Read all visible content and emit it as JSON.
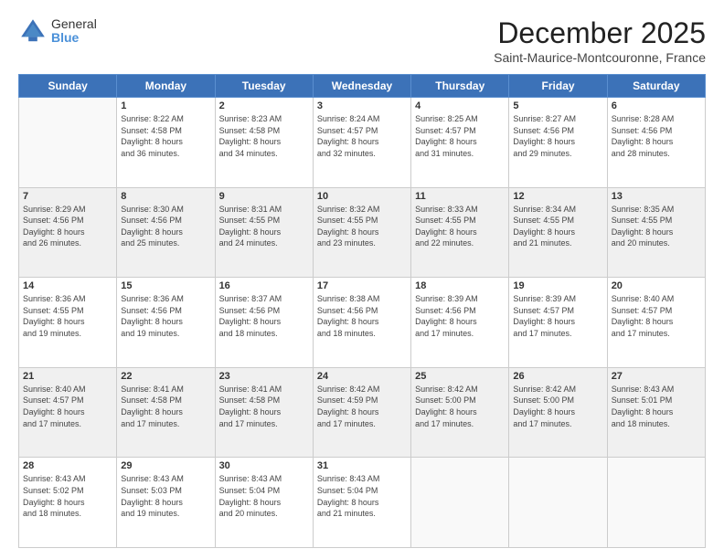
{
  "header": {
    "logo": {
      "general": "General",
      "blue": "Blue"
    },
    "title": "December 2025",
    "location": "Saint-Maurice-Montcouronne, France"
  },
  "weekdays": [
    "Sunday",
    "Monday",
    "Tuesday",
    "Wednesday",
    "Thursday",
    "Friday",
    "Saturday"
  ],
  "weeks": [
    [
      {
        "day": "",
        "info": ""
      },
      {
        "day": "1",
        "info": "Sunrise: 8:22 AM\nSunset: 4:58 PM\nDaylight: 8 hours\nand 36 minutes."
      },
      {
        "day": "2",
        "info": "Sunrise: 8:23 AM\nSunset: 4:58 PM\nDaylight: 8 hours\nand 34 minutes."
      },
      {
        "day": "3",
        "info": "Sunrise: 8:24 AM\nSunset: 4:57 PM\nDaylight: 8 hours\nand 32 minutes."
      },
      {
        "day": "4",
        "info": "Sunrise: 8:25 AM\nSunset: 4:57 PM\nDaylight: 8 hours\nand 31 minutes."
      },
      {
        "day": "5",
        "info": "Sunrise: 8:27 AM\nSunset: 4:56 PM\nDaylight: 8 hours\nand 29 minutes."
      },
      {
        "day": "6",
        "info": "Sunrise: 8:28 AM\nSunset: 4:56 PM\nDaylight: 8 hours\nand 28 minutes."
      }
    ],
    [
      {
        "day": "7",
        "info": "Sunrise: 8:29 AM\nSunset: 4:56 PM\nDaylight: 8 hours\nand 26 minutes."
      },
      {
        "day": "8",
        "info": "Sunrise: 8:30 AM\nSunset: 4:56 PM\nDaylight: 8 hours\nand 25 minutes."
      },
      {
        "day": "9",
        "info": "Sunrise: 8:31 AM\nSunset: 4:55 PM\nDaylight: 8 hours\nand 24 minutes."
      },
      {
        "day": "10",
        "info": "Sunrise: 8:32 AM\nSunset: 4:55 PM\nDaylight: 8 hours\nand 23 minutes."
      },
      {
        "day": "11",
        "info": "Sunrise: 8:33 AM\nSunset: 4:55 PM\nDaylight: 8 hours\nand 22 minutes."
      },
      {
        "day": "12",
        "info": "Sunrise: 8:34 AM\nSunset: 4:55 PM\nDaylight: 8 hours\nand 21 minutes."
      },
      {
        "day": "13",
        "info": "Sunrise: 8:35 AM\nSunset: 4:55 PM\nDaylight: 8 hours\nand 20 minutes."
      }
    ],
    [
      {
        "day": "14",
        "info": "Sunrise: 8:36 AM\nSunset: 4:55 PM\nDaylight: 8 hours\nand 19 minutes."
      },
      {
        "day": "15",
        "info": "Sunrise: 8:36 AM\nSunset: 4:56 PM\nDaylight: 8 hours\nand 19 minutes."
      },
      {
        "day": "16",
        "info": "Sunrise: 8:37 AM\nSunset: 4:56 PM\nDaylight: 8 hours\nand 18 minutes."
      },
      {
        "day": "17",
        "info": "Sunrise: 8:38 AM\nSunset: 4:56 PM\nDaylight: 8 hours\nand 18 minutes."
      },
      {
        "day": "18",
        "info": "Sunrise: 8:39 AM\nSunset: 4:56 PM\nDaylight: 8 hours\nand 17 minutes."
      },
      {
        "day": "19",
        "info": "Sunrise: 8:39 AM\nSunset: 4:57 PM\nDaylight: 8 hours\nand 17 minutes."
      },
      {
        "day": "20",
        "info": "Sunrise: 8:40 AM\nSunset: 4:57 PM\nDaylight: 8 hours\nand 17 minutes."
      }
    ],
    [
      {
        "day": "21",
        "info": "Sunrise: 8:40 AM\nSunset: 4:57 PM\nDaylight: 8 hours\nand 17 minutes."
      },
      {
        "day": "22",
        "info": "Sunrise: 8:41 AM\nSunset: 4:58 PM\nDaylight: 8 hours\nand 17 minutes."
      },
      {
        "day": "23",
        "info": "Sunrise: 8:41 AM\nSunset: 4:58 PM\nDaylight: 8 hours\nand 17 minutes."
      },
      {
        "day": "24",
        "info": "Sunrise: 8:42 AM\nSunset: 4:59 PM\nDaylight: 8 hours\nand 17 minutes."
      },
      {
        "day": "25",
        "info": "Sunrise: 8:42 AM\nSunset: 5:00 PM\nDaylight: 8 hours\nand 17 minutes."
      },
      {
        "day": "26",
        "info": "Sunrise: 8:42 AM\nSunset: 5:00 PM\nDaylight: 8 hours\nand 17 minutes."
      },
      {
        "day": "27",
        "info": "Sunrise: 8:43 AM\nSunset: 5:01 PM\nDaylight: 8 hours\nand 18 minutes."
      }
    ],
    [
      {
        "day": "28",
        "info": "Sunrise: 8:43 AM\nSunset: 5:02 PM\nDaylight: 8 hours\nand 18 minutes."
      },
      {
        "day": "29",
        "info": "Sunrise: 8:43 AM\nSunset: 5:03 PM\nDaylight: 8 hours\nand 19 minutes."
      },
      {
        "day": "30",
        "info": "Sunrise: 8:43 AM\nSunset: 5:04 PM\nDaylight: 8 hours\nand 20 minutes."
      },
      {
        "day": "31",
        "info": "Sunrise: 8:43 AM\nSunset: 5:04 PM\nDaylight: 8 hours\nand 21 minutes."
      },
      {
        "day": "",
        "info": ""
      },
      {
        "day": "",
        "info": ""
      },
      {
        "day": "",
        "info": ""
      }
    ]
  ]
}
